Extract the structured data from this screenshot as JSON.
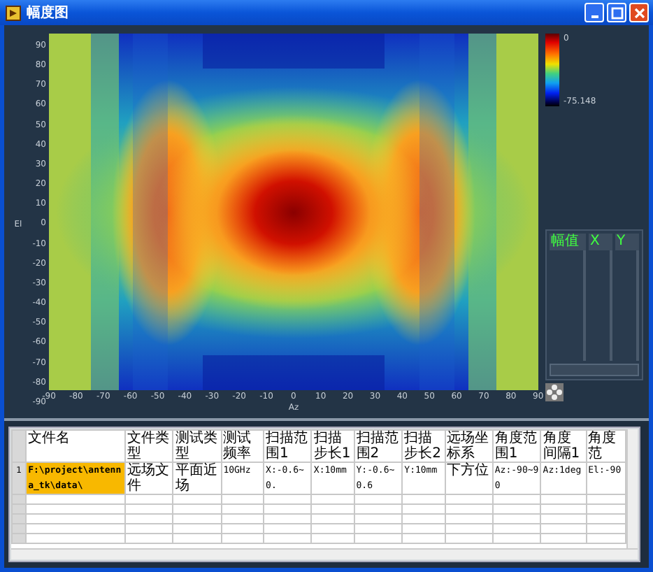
{
  "window": {
    "title": "幅度图"
  },
  "plot": {
    "y_label": "El",
    "x_label": "Az",
    "y_ticks": [
      "90",
      "80",
      "70",
      "60",
      "50",
      "40",
      "30",
      "20",
      "10",
      "0",
      "-10",
      "-20",
      "-30",
      "-40",
      "-50",
      "-60",
      "-70",
      "-80",
      "-90"
    ],
    "x_ticks": [
      "-90",
      "-80",
      "-70",
      "-60",
      "-50",
      "-40",
      "-30",
      "-20",
      "-10",
      "0",
      "10",
      "20",
      "30",
      "40",
      "50",
      "60",
      "70",
      "80",
      "90"
    ],
    "colorbar": {
      "max_label": "0",
      "min_label": "-75.148"
    }
  },
  "cursor_table": {
    "columns": [
      "幅值",
      "X",
      "Y"
    ]
  },
  "file_table": {
    "columns": [
      "文件名",
      "文件类型",
      "测试类型",
      "测试频率",
      "扫描范围1",
      "扫描步长1",
      "扫描范围2",
      "扫描步长2",
      "远场坐标系",
      "角度范围1",
      "角度间隔1",
      "角度范"
    ],
    "rows": [
      {
        "number": "1",
        "cells": [
          {
            "text": "F:\\project\\antenna_tk\\data\\",
            "selected": true
          },
          {
            "text": "远场文件",
            "selected": false
          },
          {
            "text": "平面近场",
            "selected": false
          },
          {
            "text": "10GHz",
            "selected": false
          },
          {
            "text": "X:-0.6~0.",
            "selected": false
          },
          {
            "text": "X:10mm",
            "selected": false
          },
          {
            "text": "Y:-0.6~0.6",
            "selected": false
          },
          {
            "text": "Y:10mm",
            "selected": false
          },
          {
            "text": "下方位",
            "selected": false
          },
          {
            "text": "Az:-90~90",
            "selected": false
          },
          {
            "text": "Az:1deg",
            "selected": false
          },
          {
            "text": "El:-90",
            "selected": false
          }
        ]
      }
    ]
  }
}
